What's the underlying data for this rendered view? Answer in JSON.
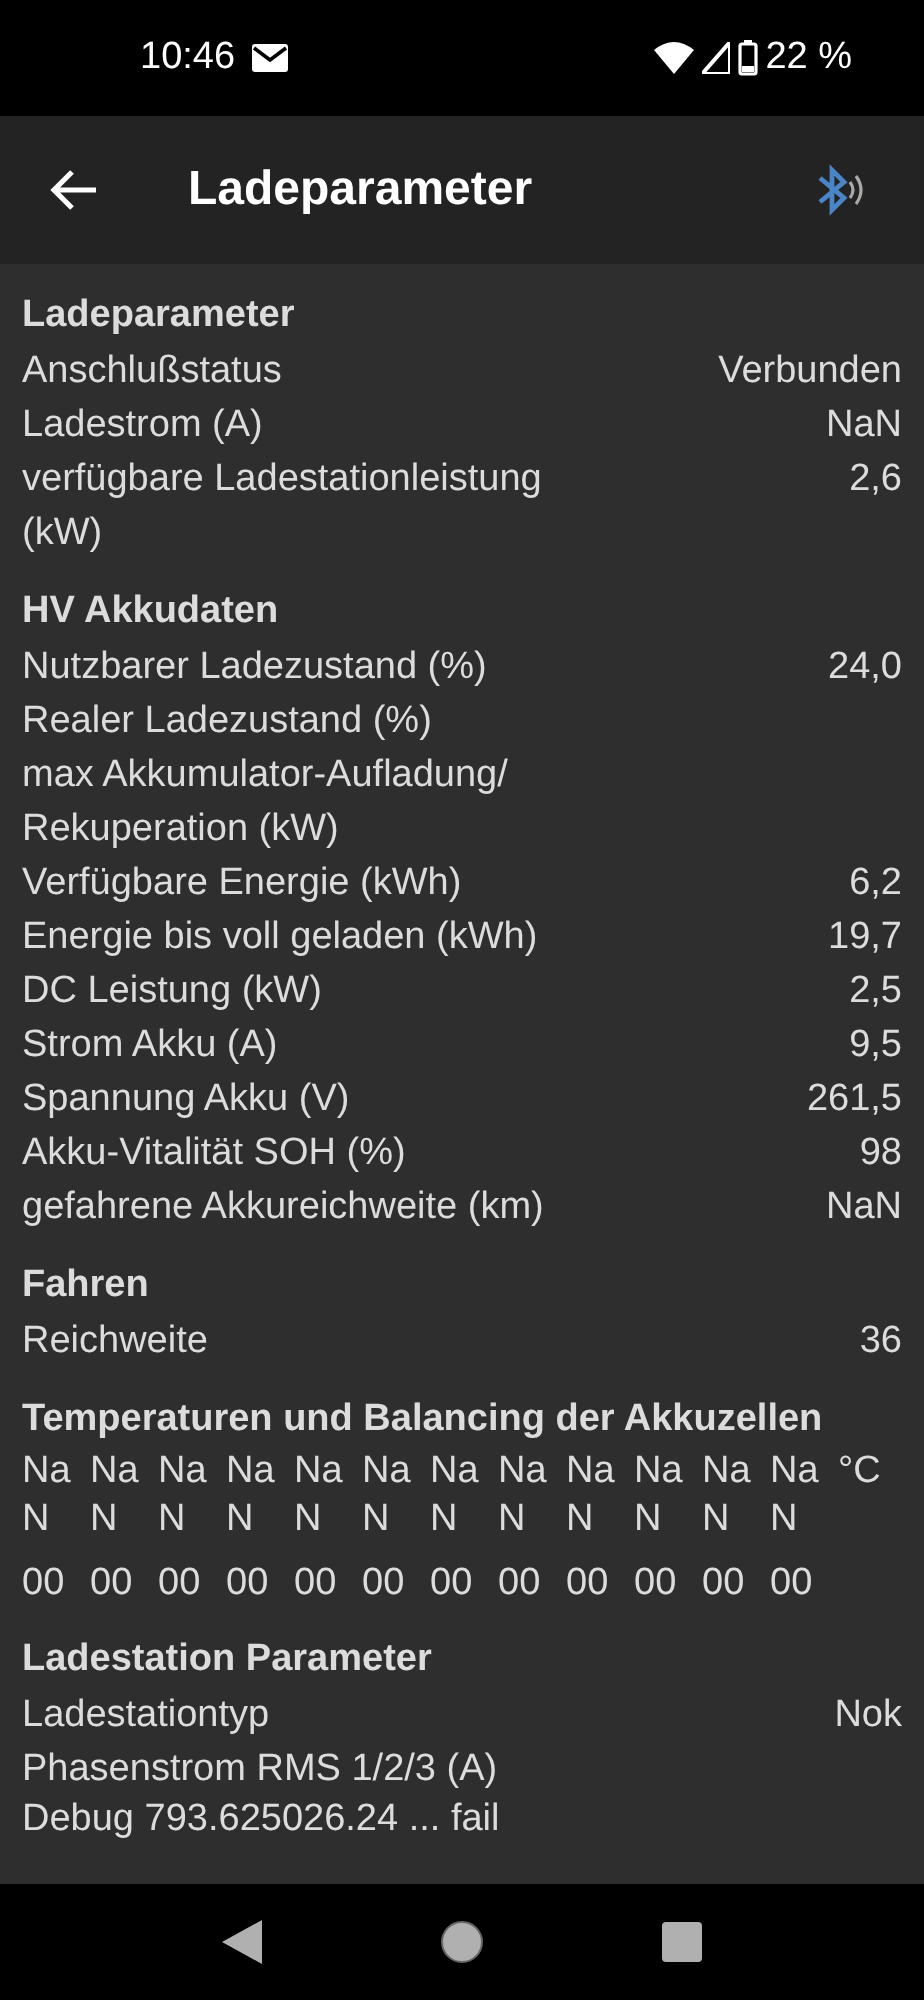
{
  "status_bar": {
    "time": "10:46",
    "battery": "22 %"
  },
  "app_bar": {
    "title": "Ladeparameter"
  },
  "sections": [
    {
      "title": "Ladeparameter",
      "rows": [
        {
          "label": "Anschlußstatus",
          "value": "Verbunden"
        },
        {
          "label": "Ladestrom (A)",
          "value": "NaN"
        },
        {
          "label": "verfügbare Ladestationleistung (kW)",
          "value": "2,6"
        }
      ]
    },
    {
      "title": "HV Akkudaten",
      "rows": [
        {
          "label": "Nutzbarer Ladezustand (%)",
          "value": "24,0"
        },
        {
          "label": "Realer Ladezustand (%)"
        },
        {
          "label": "max Akkumulator-Aufladung/ Rekuperation (kW)"
        },
        {
          "label": "Verfügbare Energie (kWh)",
          "value": "6,2"
        },
        {
          "label": "Energie bis voll geladen (kWh)",
          "value": "19,7"
        },
        {
          "label": "DC Leistung (kW)",
          "value": "2,5"
        },
        {
          "label": "Strom Akku (A)",
          "value": "9,5"
        },
        {
          "label": "Spannung Akku (V)",
          "value": "261,5"
        },
        {
          "label": "Akku-Vitalität SOH (%)",
          "value": "98"
        },
        {
          "label": "gefahrene Akkureichweite (km)",
          "value": "NaN"
        }
      ]
    },
    {
      "title": "Fahren",
      "rows": [
        {
          "label": "Reichweite",
          "value": "36"
        }
      ]
    },
    {
      "title": "Temperaturen und Balancing der Akkuzellen",
      "cells": [
        {
          "temp": "NaN",
          "balance": "00"
        },
        {
          "temp": "NaN",
          "balance": "00"
        },
        {
          "temp": "NaN",
          "balance": "00"
        },
        {
          "temp": "NaN",
          "balance": "00"
        },
        {
          "temp": "NaN",
          "balance": "00"
        },
        {
          "temp": "NaN",
          "balance": "00"
        },
        {
          "temp": "NaN",
          "balance": "00"
        },
        {
          "temp": "NaN",
          "balance": "00"
        },
        {
          "temp": "NaN",
          "balance": "00"
        },
        {
          "temp": "NaN",
          "balance": "00"
        },
        {
          "temp": "NaN",
          "balance": "00"
        },
        {
          "temp": "NaN",
          "balance": "00"
        }
      ],
      "unit": "°C"
    },
    {
      "title": "Ladestation Parameter",
      "rows": [
        {
          "label": "Ladestationtyp",
          "value": "Nok"
        },
        {
          "label": "Phasenstrom RMS 1/2/3 (A)"
        }
      ]
    }
  ],
  "debug": "Debug 793.625026.24 ... fail"
}
